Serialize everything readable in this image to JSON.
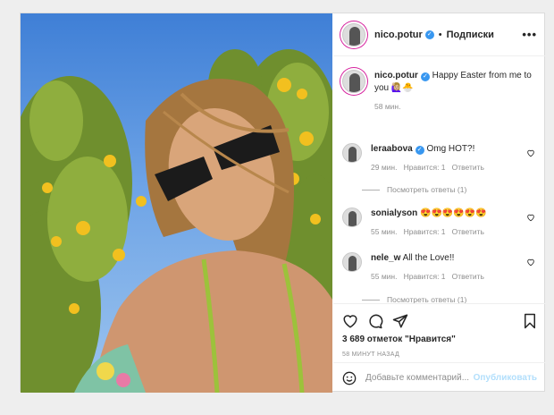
{
  "post": {
    "username": "nico.potur",
    "follow_label": "Подписки",
    "more_label": "•••",
    "caption": {
      "username": "nico.potur",
      "text": "Happy Easter from me to you 🙋🏼‍♀️🐣",
      "time": "58 мин."
    },
    "comments": [
      {
        "username": "leraabova",
        "text": "Omg HOT?!",
        "time": "29 мин.",
        "likes": "Нравится: 1",
        "reply": "Ответить",
        "view_replies": "Посмотреть ответы (1)"
      },
      {
        "username": "sonialyson",
        "text": "😍😍😍😍😍😍",
        "time": "55 мин.",
        "likes": "Нравится: 1",
        "reply": "Ответить"
      },
      {
        "username": "nele_w",
        "text": "All the Love!!",
        "time": "55 мин.",
        "likes": "Нравится: 1",
        "reply": "Ответить",
        "view_replies": "Посмотреть ответы (1)"
      }
    ],
    "likes_text": "3 689 отметок \"Нравится\"",
    "timestamp": "58 МИНУТ НАЗАД",
    "add_comment_placeholder": "Добавьте комментарий...",
    "publish_label": "Опубликовать",
    "colors": {
      "verified": "#3897f0",
      "publish": "#b2dffc",
      "muted": "#8e8e8e"
    }
  }
}
